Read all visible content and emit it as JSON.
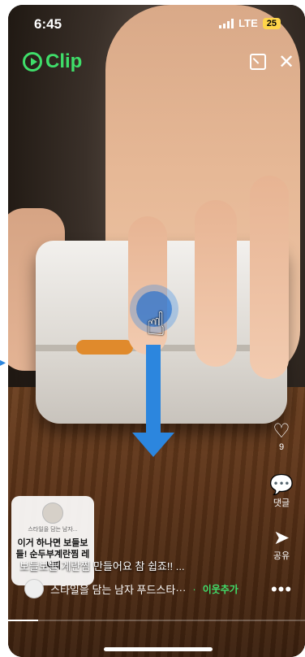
{
  "status_bar": {
    "time": "6:45",
    "network": "LTE",
    "battery": "25"
  },
  "app": {
    "logo_text": "Clip"
  },
  "actions": {
    "like_count": "9",
    "comment_label": "댓글",
    "share_label": "공유",
    "more_label": "•••"
  },
  "card": {
    "subtitle": "스타일을 담는 남자...",
    "title": "이거 하나면 보들보들! 순두부계란찜 레시피"
  },
  "video": {
    "caption": "보들보들 계란찜 만들어요 참 쉽죠!! ...",
    "channel_name": "스타일을 담는 남자 푸드스타···",
    "follow_label": "이웃추가",
    "progress": 0.1
  },
  "colors": {
    "accent": "#3fde6a",
    "cursor": "#2c86de"
  }
}
